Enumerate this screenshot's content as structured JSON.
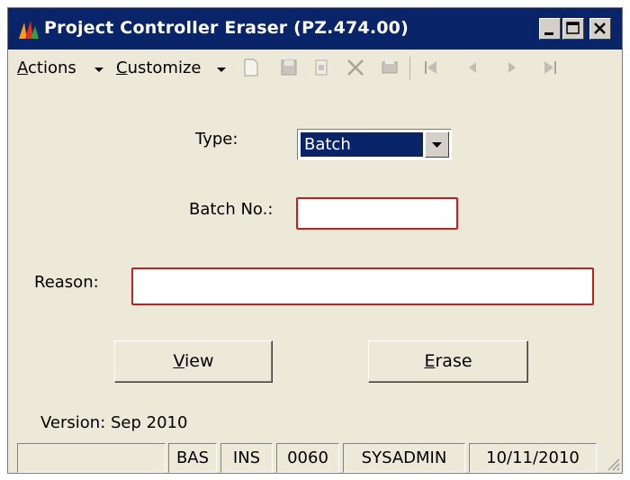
{
  "window": {
    "title": "Project Controller Eraser (PZ.474.00)",
    "icon": "app-logo-icon",
    "controls": [
      "minimize-icon",
      "maximize-icon",
      "close-icon"
    ]
  },
  "toolbar": {
    "actions_label_u": "A",
    "actions_label_rest": "ctions",
    "customize_label_u": "C",
    "customize_label_rest": "ustomize",
    "icons": [
      "new-icon",
      "save-icon",
      "copy-icon",
      "delete-icon",
      "print-icon",
      "first-icon",
      "previous-icon",
      "next-icon",
      "last-icon"
    ]
  },
  "form": {
    "type_label": "Type:",
    "type_value": "Batch",
    "batch_label": "Batch No.:",
    "batch_value": "",
    "reason_label": "Reason:",
    "reason_value": ""
  },
  "buttons": {
    "view_u": "V",
    "view_rest": "iew",
    "erase_u": "E",
    "erase_rest": "rase"
  },
  "version": "Version: Sep 2010",
  "status": {
    "cell1": "",
    "company": "BAS",
    "mode": "INS",
    "code": "0060",
    "user": "SYSADMIN",
    "date": "10/11/2010"
  },
  "colors": {
    "titlebar": "#0a246a",
    "window_bg": "#ece9d8",
    "required_border": "#c41e1e"
  }
}
